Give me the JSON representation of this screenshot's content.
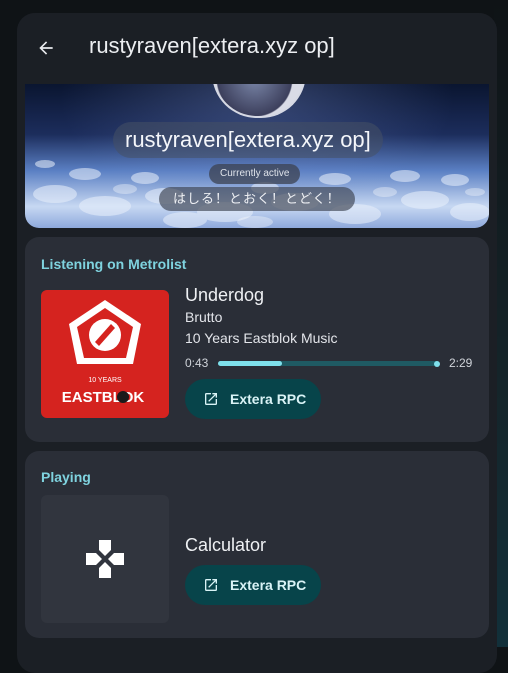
{
  "topbar": {
    "back_icon": "arrow-left-icon",
    "title": "rustyraven[extera.xyz op]"
  },
  "profile": {
    "display_name": "rustyraven[extera.xyz op]",
    "active_label": "Currently active",
    "status_text": "はしる！とおく！とどく！"
  },
  "listening": {
    "heading": "Listening on Metrolist",
    "track": "Underdog",
    "artist": "Brutto",
    "album": "10 Years Eastblok Music",
    "time_elapsed": "0:43",
    "time_total": "2:29",
    "progress": 0.29,
    "art_text_top": "10 YEARS",
    "art_text_brand": "EASTBLOK",
    "button_label": "Extera RPC",
    "button_icon": "open-in-new-icon"
  },
  "playing": {
    "heading": "Playing",
    "game": "Calculator",
    "game_icon": "gamepad-icon",
    "button_label": "Extera RPC",
    "button_icon": "open-in-new-icon"
  },
  "colors": {
    "accent": "#7fd3df",
    "card": "#2a2e37",
    "button": "#07444a",
    "album_red": "#d5231f"
  }
}
